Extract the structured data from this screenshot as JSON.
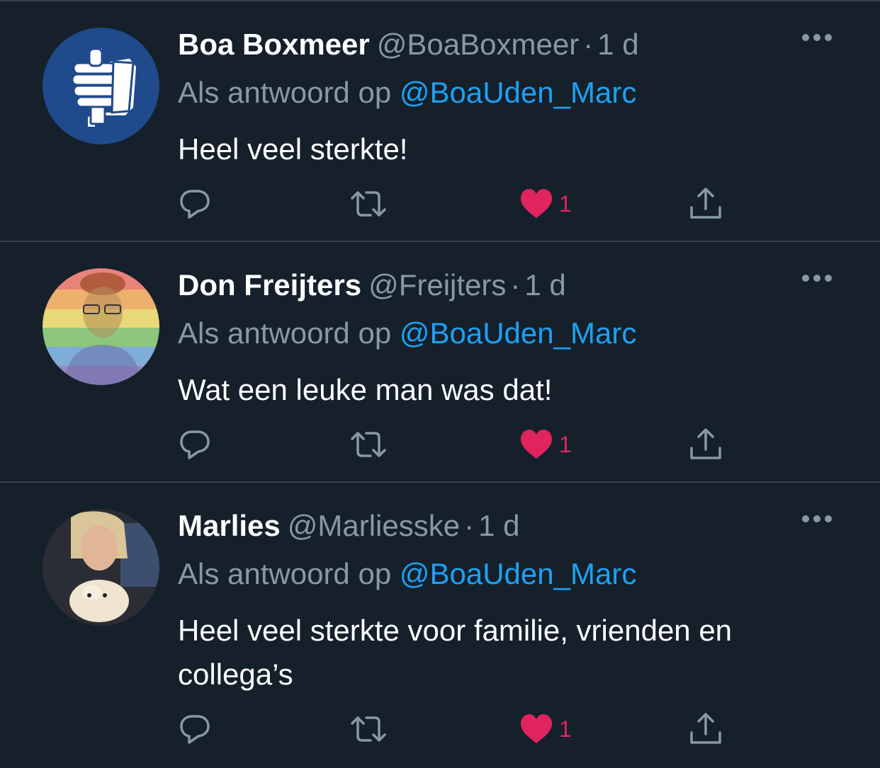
{
  "tweets": [
    {
      "name": "Boa Boxmeer",
      "handle": "@BoaBoxmeer",
      "separator": "·",
      "time": "1 d",
      "reply_prefix": "Als antwoord op",
      "reply_to": "@BoaUden_Marc",
      "text": "Heel veel sterkte!",
      "likes": "1",
      "avatar": "thumbs-up-logo"
    },
    {
      "name": "Don Freijters",
      "handle": "@Freijters",
      "separator": "·",
      "time": "1 d",
      "reply_prefix": "Als antwoord op",
      "reply_to": "@BoaUden_Marc",
      "text": "Wat een leuke man was dat!",
      "likes": "1",
      "avatar": "rainbow-photo"
    },
    {
      "name": "Marlies",
      "handle": "@Marliesske",
      "separator": "·",
      "time": "1 d",
      "reply_prefix": "Als antwoord op",
      "reply_to": "@BoaUden_Marc",
      "text": "Heel veel sterkte voor familie, vrienden en collega’s",
      "likes": "1",
      "avatar": "photo-with-dog"
    }
  ],
  "colors": {
    "background": "#15202b",
    "divider": "#38444d",
    "secondary_text": "#8899a6",
    "mention": "#1da1f2",
    "like": "#e0245e"
  },
  "icons": {
    "reply": "reply-icon",
    "retweet": "retweet-icon",
    "like": "heart-icon",
    "share": "share-icon",
    "more": "more-icon"
  }
}
